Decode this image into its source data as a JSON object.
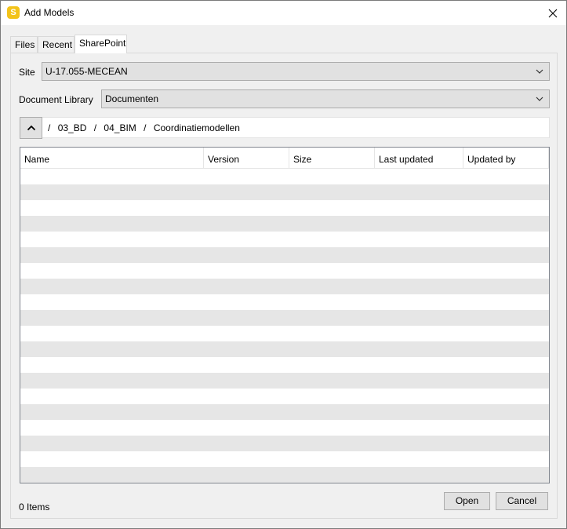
{
  "window": {
    "title": "Add Models",
    "app_icon_letter": "S"
  },
  "tabs": [
    {
      "label": "Files",
      "active": false
    },
    {
      "label": "Recent",
      "active": false
    },
    {
      "label": "SharePoint",
      "active": true
    }
  ],
  "site": {
    "label": "Site",
    "value": "U-17.055-MECEAN"
  },
  "library": {
    "label": "Document Library",
    "value": "Documenten"
  },
  "breadcrumb": {
    "separator": "/",
    "items": [
      "03_BD",
      "04_BIM",
      "Coordinatiemodellen"
    ]
  },
  "list": {
    "columns": [
      "Name",
      "Version",
      "Size",
      "Last updated",
      "Updated by"
    ],
    "rows": []
  },
  "status": {
    "item_count": "0 Items"
  },
  "buttons": {
    "open": "Open",
    "cancel": "Cancel"
  }
}
